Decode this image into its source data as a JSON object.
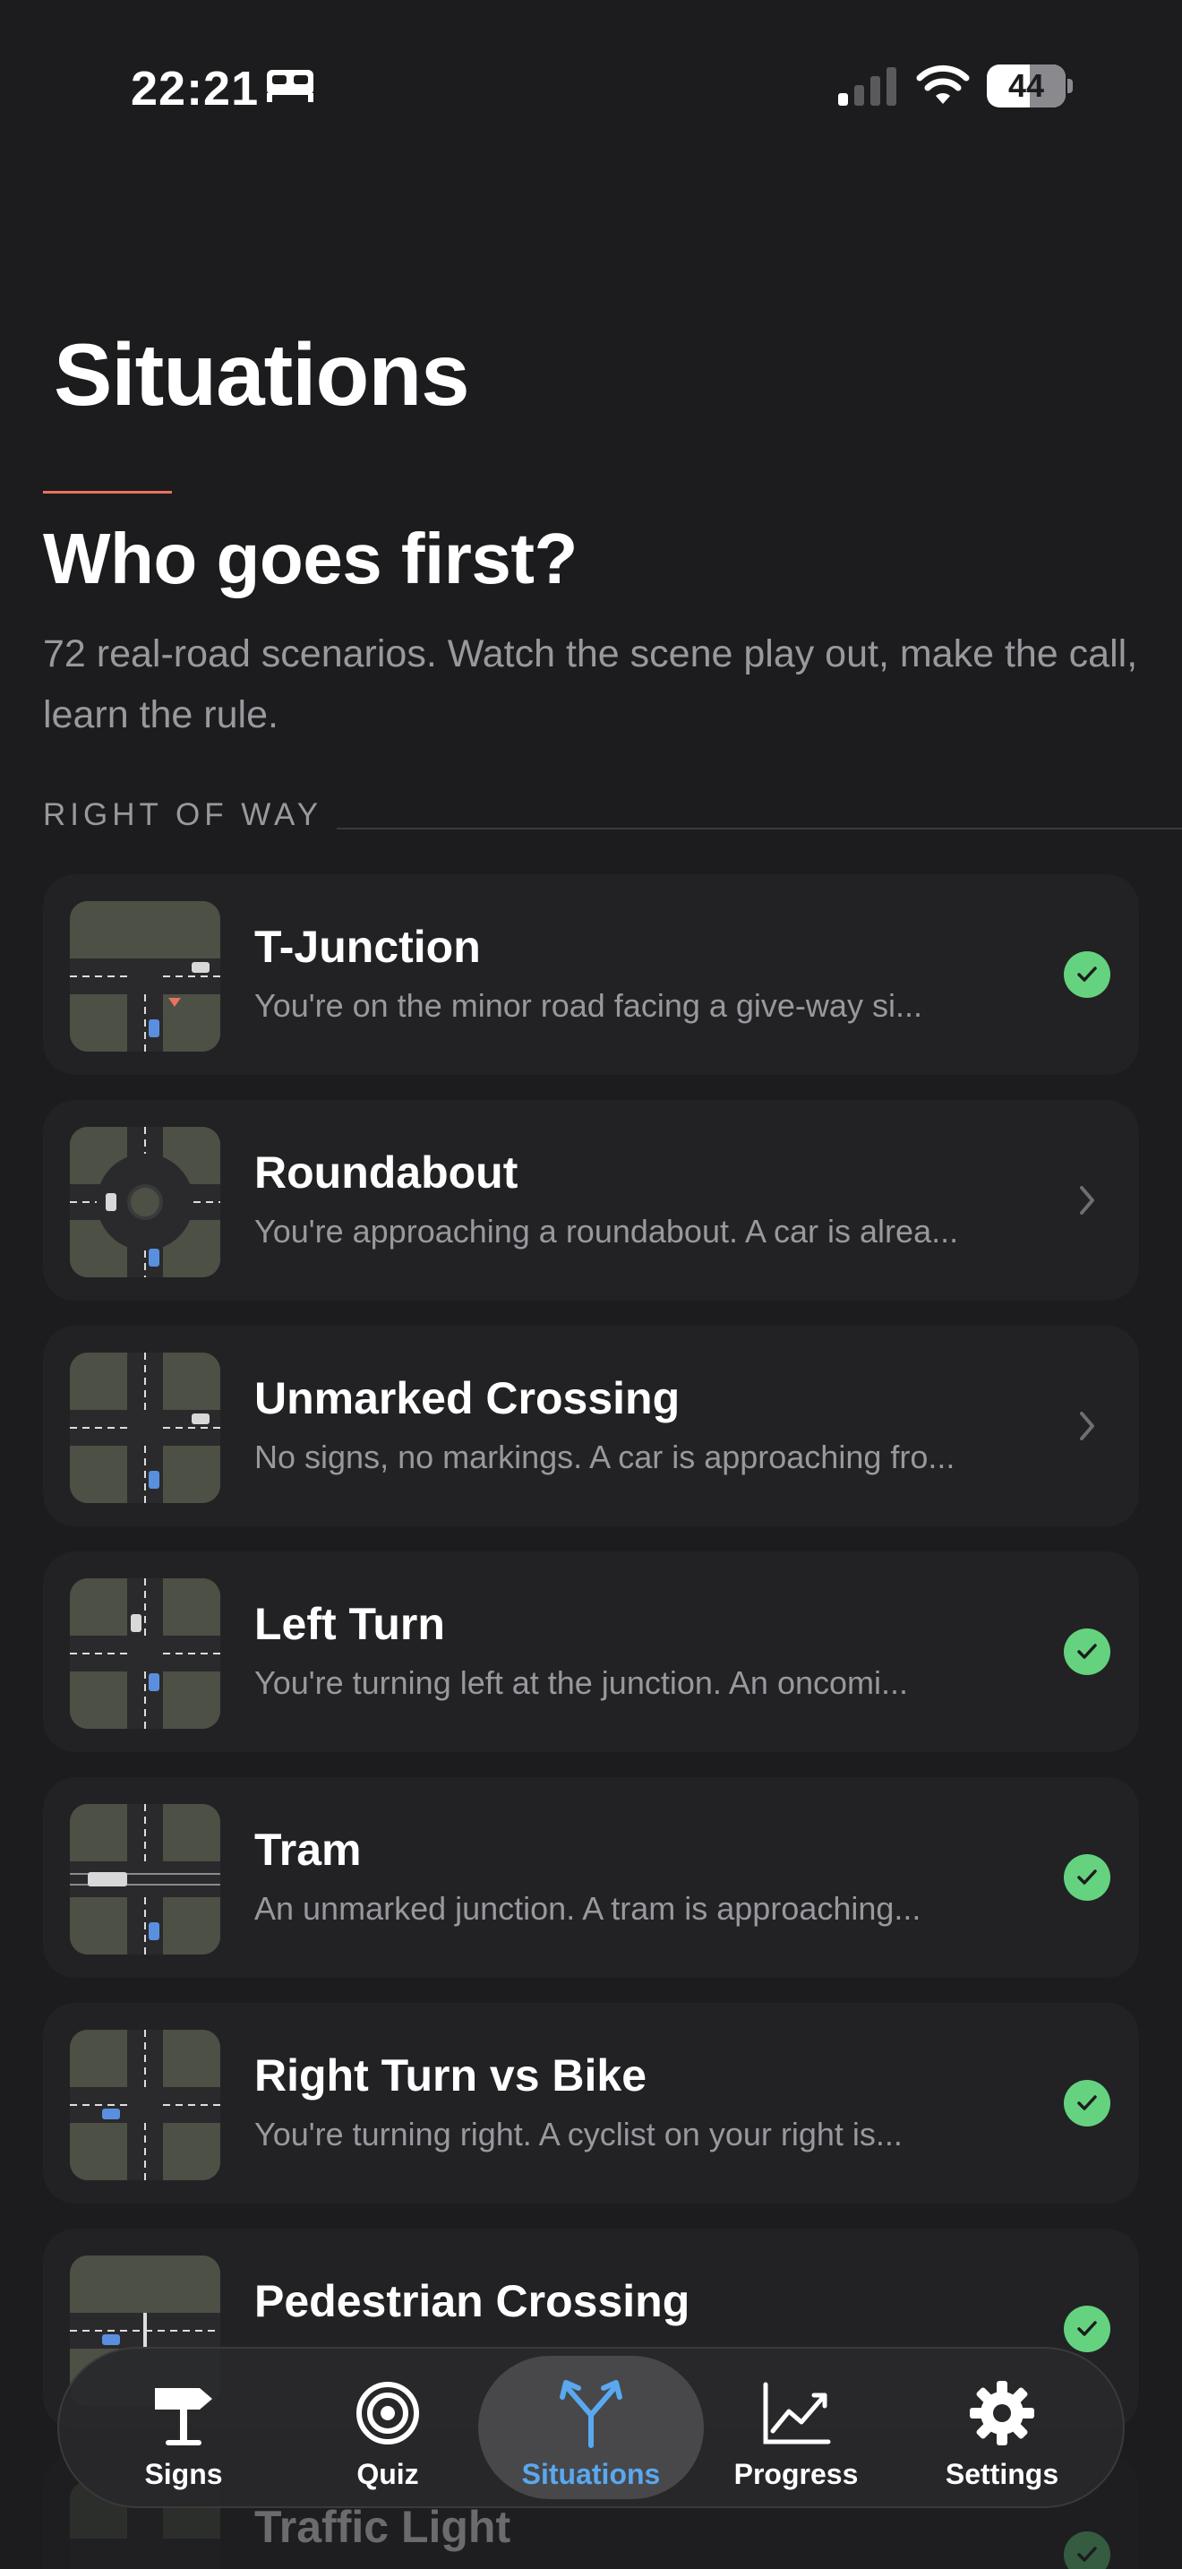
{
  "status_bar": {
    "time": "22:21",
    "battery": "44"
  },
  "page": {
    "title": "Situations",
    "heading": "Who goes first?",
    "intro": "72 real-road scenarios. Watch the scene play out, make the call, learn the rule.",
    "section_label": "RIGHT OF WAY"
  },
  "situations": [
    {
      "title": "T-Junction",
      "subtitle": "You're on the minor road facing a give-way si...",
      "status": "done"
    },
    {
      "title": "Roundabout",
      "subtitle": "You're approaching a roundabout. A car is alrea...",
      "status": "open"
    },
    {
      "title": "Unmarked Crossing",
      "subtitle": "No signs, no markings. A car is approaching fro...",
      "status": "open"
    },
    {
      "title": "Left Turn",
      "subtitle": "You're turning left at the junction. An oncomi...",
      "status": "done"
    },
    {
      "title": "Tram",
      "subtitle": "An unmarked junction. A tram is approaching...",
      "status": "done"
    },
    {
      "title": "Right Turn vs Bike",
      "subtitle": "You're turning right. A cyclist on your right is...",
      "status": "done"
    },
    {
      "title": "Pedestrian Crossing",
      "subtitle": "",
      "status": "done"
    },
    {
      "title": "Traffic Light",
      "subtitle": "",
      "status": "done"
    }
  ],
  "tabs": [
    {
      "label": "Signs",
      "icon": "signpost-icon"
    },
    {
      "label": "Quiz",
      "icon": "target-icon"
    },
    {
      "label": "Situations",
      "icon": "merge-arrows-icon",
      "active": true
    },
    {
      "label": "Progress",
      "icon": "chart-line-icon"
    },
    {
      "label": "Settings",
      "icon": "gear-icon"
    }
  ]
}
